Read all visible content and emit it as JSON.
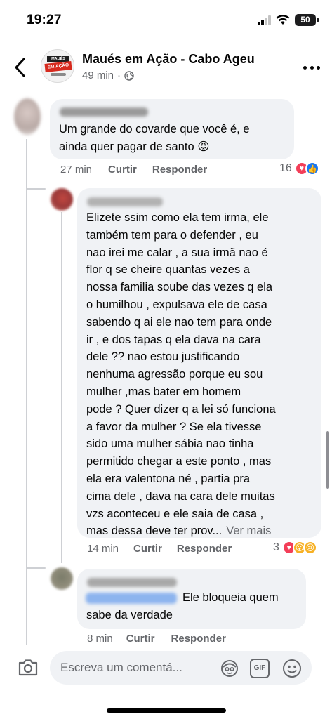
{
  "status_bar": {
    "time": "19:27",
    "battery": "50"
  },
  "header": {
    "title": "Maués em Ação - Cabo Ageu",
    "post_age": "49 min",
    "logo_text_top": "MAUÉS",
    "logo_text_band": "EM AÇÃO"
  },
  "comments": [
    {
      "lines": [
        "Um grande do covarde que você é, e",
        "ainda quer pagar de santo 😡"
      ],
      "time": "27 min",
      "like_label": "Curtir",
      "reply_label": "Responder",
      "reaction_count": "16",
      "reactions": [
        "love",
        "like"
      ]
    },
    {
      "lines": [
        "Elizete ssim como ela tem irma, ele",
        "também tem para o defender , eu",
        "nao irei me calar , a sua irmã nao é",
        "flor q se cheire quantas vezes a",
        "nossa familia soube das vezes q ela",
        "o humilhou , expulsava ele de casa",
        "sabendo q ai ele nao tem para onde",
        "ir , e dos tapas q ela dava na cara",
        "dele ?? nao estou justificando",
        "nenhuma agressão porque eu sou",
        "mulher ,mas bater em homem",
        "pode ? Quer dizer q a lei só funciona",
        "a favor da mulher ?  Se ela tivesse",
        "sido uma mulher sábia nao tinha",
        "permitido chegar a este ponto , mas",
        "ela era valentona né , partia pra",
        "cima dele , dava na cara dele muitas",
        "vzs aconteceu e ele saia de casa ,",
        "mas dessa deve ter prov..."
      ],
      "see_more": "Ver mais",
      "time": "14 min",
      "like_label": "Curtir",
      "reply_label": "Responder",
      "reaction_count": "3",
      "reactions": [
        "love",
        "wow",
        "sad"
      ]
    },
    {
      "lines": [
        "Ele bloqueia quem",
        "sabe da verdade"
      ],
      "time": "8 min",
      "like_label": "Curtir",
      "reply_label": "Responder"
    }
  ],
  "composer": {
    "placeholder": "Escreva um comentá...",
    "gif_label": "GIF"
  },
  "colors": {
    "like": "#1877f2",
    "love": "#f33e58",
    "wow": "#f7b125",
    "sad": "#f7b125",
    "bubble": "#f0f2f5",
    "meta_gray": "#65676b"
  },
  "icons": [
    "back-chevron-icon",
    "globe-icon",
    "more-dots-icon",
    "camera-icon",
    "avatar-sticker-icon",
    "gif-icon",
    "emoji-icon"
  ]
}
